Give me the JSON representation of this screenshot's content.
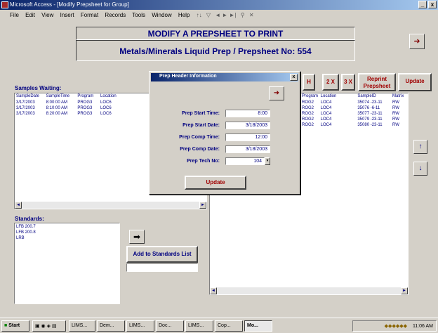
{
  "window": {
    "title": "Microsoft Access - [Modify Prepsheet for Group]",
    "minimize": "_",
    "close": "x"
  },
  "menu": {
    "items": [
      "File",
      "Edit",
      "View",
      "Insert",
      "Format",
      "Records",
      "Tools",
      "Window",
      "Help"
    ]
  },
  "header": {
    "title": "MODIFY A PREPSHEET TO PRINT",
    "subtitle": "Metals/Minerals Liquid Prep / Prepsheet No: 554"
  },
  "toolbar": {
    "nav_first": "H",
    "btn_2x": "2 X",
    "btn_3x": "3 X",
    "reprint": "Reprint Prepsheet",
    "update": "Update"
  },
  "samples": {
    "label": "Samples Waiting:",
    "columns": [
      "SampleDate",
      "SampleTime",
      "Program",
      "Location"
    ],
    "rows": [
      [
        "3/17/2003",
        "8:00:00 AM",
        "PROG3",
        "LOC6"
      ],
      [
        "3/17/2003",
        "8:10:00 AM",
        "PROG3",
        "LOC6"
      ],
      [
        "3/17/2003",
        "8:20:00 AM",
        "PROG3",
        "LOC6"
      ]
    ]
  },
  "prep_grid": {
    "columns": [
      "Program",
      "Location",
      "SampleID",
      "Matrix"
    ],
    "rows": [
      [
        "ROG2",
        "LOC4",
        "35074 -23-11",
        "RW"
      ],
      [
        "ROG2",
        "LOC4",
        "35076 -6-11",
        "RW"
      ],
      [
        "ROG2",
        "LOC4",
        "35077 -23-11",
        "RW"
      ],
      [
        "ROG2",
        "LOC4",
        "35079 -23-11",
        "RW"
      ],
      [
        "ROG2",
        "LOC4",
        "35080 -23-11",
        "RW"
      ]
    ]
  },
  "standards": {
    "label": "Standards:",
    "items": [
      "LFB 200.7",
      "LFB 200.8",
      "LRB"
    ],
    "add_button": "Add to Standards List",
    "input_value": ""
  },
  "dialog": {
    "title": "Prep Header Information",
    "close": "x",
    "fields": [
      {
        "label": "Prep Start Time:",
        "value": "8:00"
      },
      {
        "label": "Prep Start Date:",
        "value": "3/18/2003"
      },
      {
        "label": "Prep Comp Time:",
        "value": "12:00"
      },
      {
        "label": "Prep Comp Date:",
        "value": "3/18/2003"
      },
      {
        "label": "Prep Tech No:",
        "value": "104"
      }
    ],
    "update_button": "Update"
  },
  "taskbar": {
    "start": "Start",
    "items": [
      "LIMS...",
      "Dem...",
      "LIMS...",
      "Doc...",
      "LIMS...",
      "Cop...",
      "Mo..."
    ],
    "clock": "11:06 AM"
  }
}
